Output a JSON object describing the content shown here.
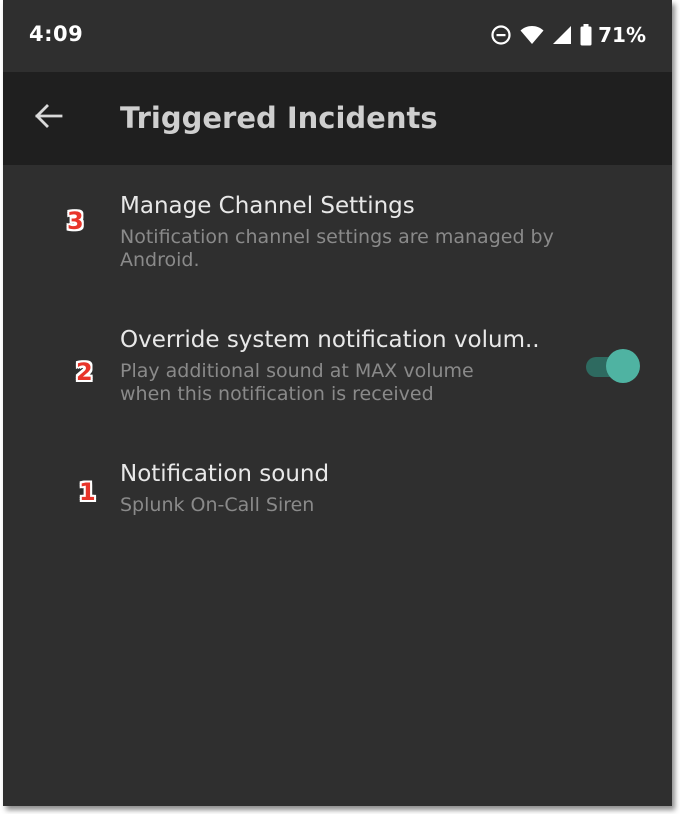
{
  "status_bar": {
    "time": "4:09",
    "battery_percent": "71%",
    "icons": [
      "do-not-disturb-icon",
      "wifi-icon",
      "cell-signal-icon",
      "battery-icon"
    ]
  },
  "app_bar": {
    "title": "Triggered Incidents",
    "back_icon": "arrow-left-icon"
  },
  "settings": [
    {
      "badge": "3",
      "title": "Manage Channel Settings",
      "subtitle": "Notification channel settings are managed by Android."
    },
    {
      "badge": "2",
      "title": "Override system notification volum..",
      "subtitle_line1": "Play additional sound at MAX volume",
      "subtitle_line2": "when this notification is received",
      "toggle_on": true
    },
    {
      "badge": "1",
      "title": "Notification sound",
      "subtitle": "Splunk On-Call Siren"
    }
  ],
  "colors": {
    "background": "#2f2f2f",
    "app_bar": "#1f1f1f",
    "title_text": "#e8e8e8",
    "subtitle_text": "#8a8a8a",
    "toggle_accent": "#4fb3a2",
    "badge": "#e8352b"
  }
}
